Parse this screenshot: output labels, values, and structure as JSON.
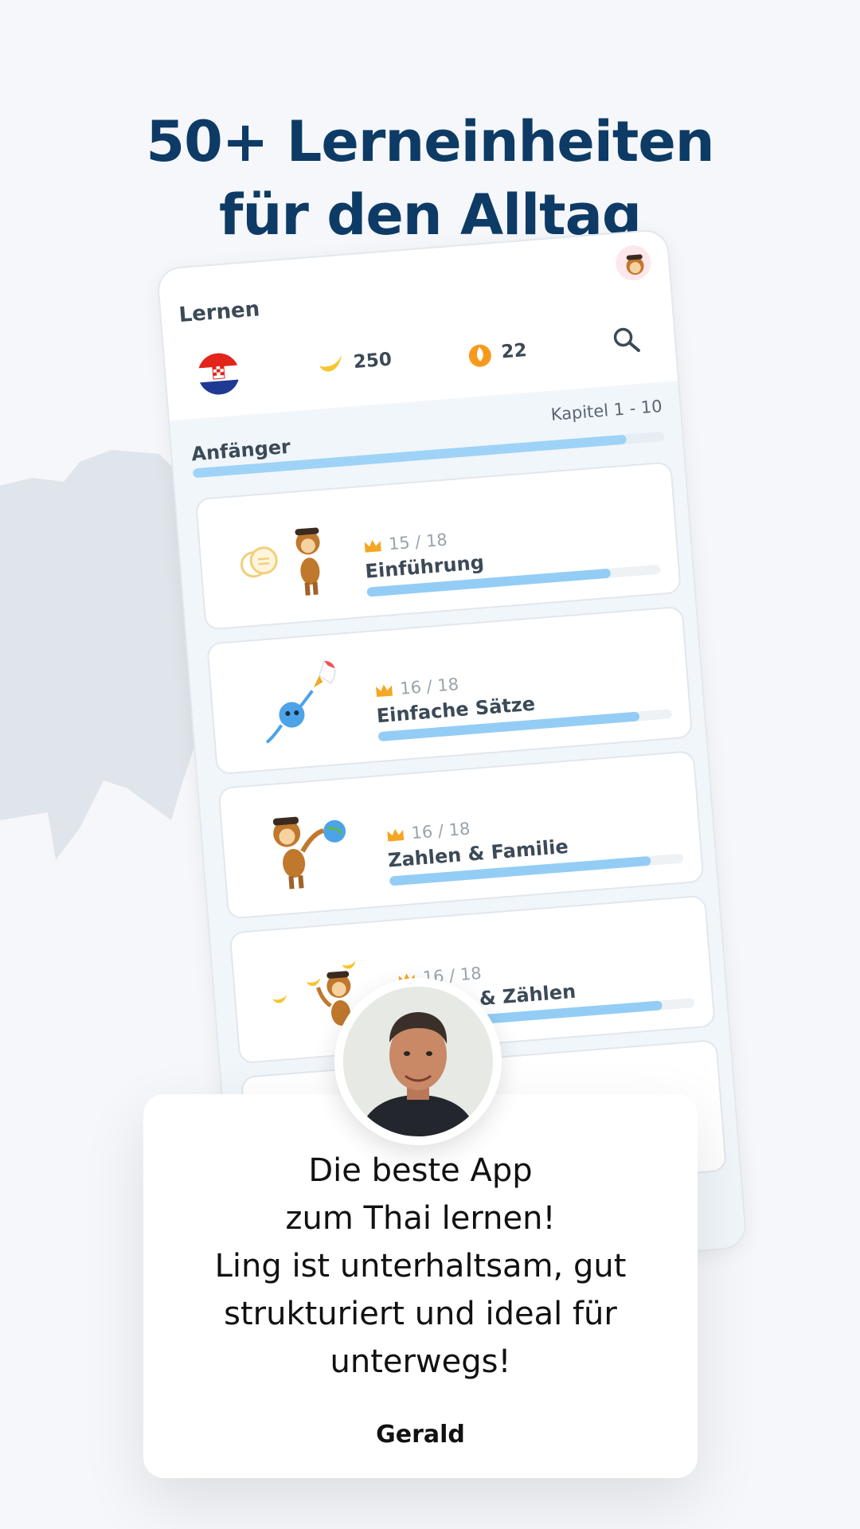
{
  "headline": {
    "line1": "50+ Lerneinheiten",
    "line2": "für den Alltag"
  },
  "app": {
    "title": "Lernen",
    "stats": {
      "bananas": "250",
      "streak": "22"
    },
    "level": {
      "name": "Anfänger",
      "chapter": "Kapitel 1 - 10",
      "progress": 0.92
    },
    "lessons": [
      {
        "count": "15 / 18",
        "name": "Einführung",
        "progress": 0.83
      },
      {
        "count": "16 / 18",
        "name": "Einfache Sätze",
        "progress": 0.89
      },
      {
        "count": "16 / 18",
        "name": "Zahlen & Familie",
        "progress": 0.89
      },
      {
        "count": "16 / 18",
        "name": "Zahlen & Zählen",
        "progress": 0.89
      }
    ]
  },
  "review": {
    "lines": [
      "Die beste App",
      "zum Thai lernen!",
      "Ling ist unterhaltsam, gut",
      "strukturiert und ideal für",
      "unterwegs!"
    ],
    "name": "Gerald"
  },
  "icons": {
    "flag": "croatia-flag-icon",
    "banana": "banana-icon",
    "streak": "flame-icon",
    "search": "search-icon",
    "crown": "crown-icon"
  },
  "colors": {
    "headline": "#0d3b66",
    "progress": "#93cdf5",
    "crown": "#f5a623",
    "flame": "#f79a1b"
  }
}
